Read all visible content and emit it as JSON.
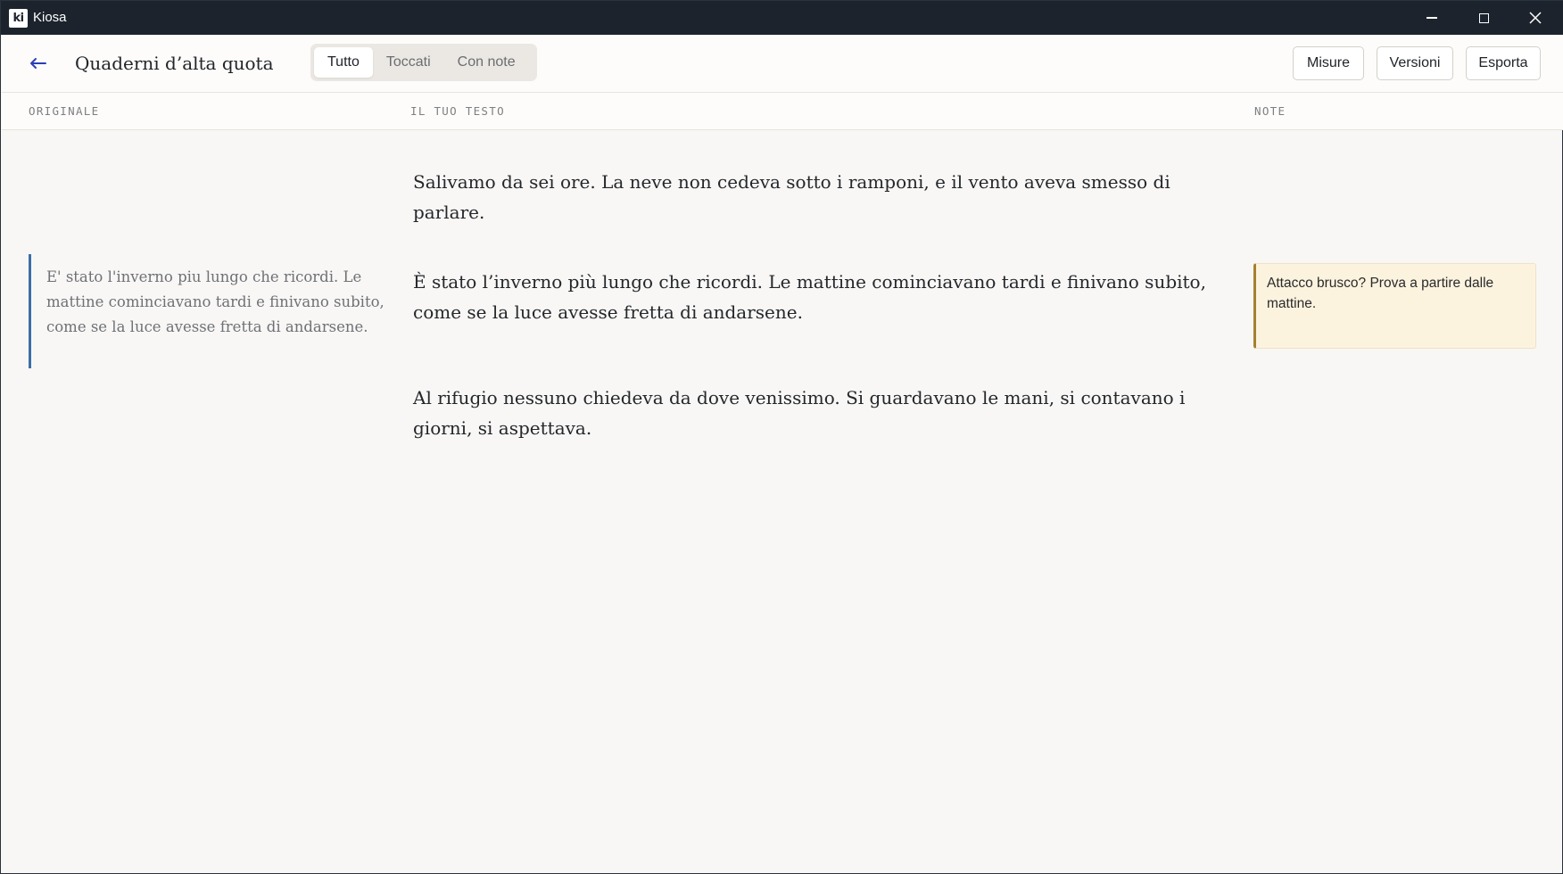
{
  "window": {
    "app_logo": "ki",
    "app_title": "Kiosa"
  },
  "toolbar": {
    "back_icon": "arrow-left-icon",
    "doc_title": "Quaderni d’alta quota",
    "filters": [
      {
        "label": "Tutto",
        "active": true
      },
      {
        "label": "Toccati",
        "active": false
      },
      {
        "label": "Con note",
        "active": false
      }
    ],
    "buttons": {
      "measures": "Misure",
      "versions": "Versioni",
      "export": "Esporta"
    }
  },
  "columns": {
    "original": "ORIGINALE",
    "your_text": "IL TUO TESTO",
    "notes": "NOTE"
  },
  "paragraphs": [
    {
      "text": "Salivamo da sei ore. La neve non cedeva sotto i ramponi, e il vento aveva smesso di parlare."
    },
    {
      "original": "E' stato l'inverno piu lungo che ricordi. Le mattine cominciavano tardi e finivano subito, come se la luce avesse fretta di andarsene.",
      "text": "È stato l’inverno più lungo che ricordi. Le mattine cominciavano tardi e finivano subito, come se la luce avesse fretta di andarsene.",
      "note": "Attacco brusco? Prova a partire dalle mattine."
    },
    {
      "text": "Al rifugio nessuno chiedeva da dove venissimo. Si guardavano le mani, si contavano i giorni, si aspettava."
    }
  ],
  "colors": {
    "titlebar": "#1c232c",
    "accent_original": "#3b6fa8",
    "accent_note": "#a5802f",
    "note_bg": "#fcf3df",
    "back_arrow": "#2b3fb5"
  }
}
